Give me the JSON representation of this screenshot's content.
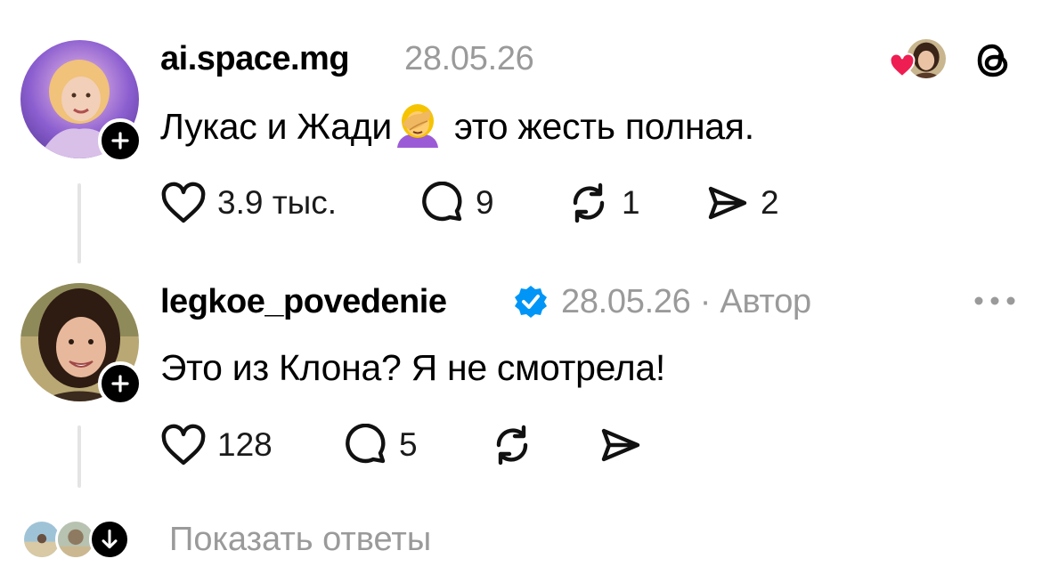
{
  "comments": [
    {
      "username": "ai.space.mg",
      "date": "28.05.26",
      "text_before_emoji": "Лукас и Жади",
      "emoji": "face-palm-emoji",
      "text_after_emoji": "это жесть полная.",
      "likes": "3.9 тыс.",
      "replies": "9",
      "reposts": "1",
      "shares": "2"
    },
    {
      "username": "legkoe_povedenie",
      "verified": true,
      "date": "28.05.26",
      "separator": "·",
      "author_label": "Автор",
      "text": "Это из Клона? Я не смотрела!",
      "likes": "128",
      "replies": "5"
    }
  ],
  "show_replies_label": "Показать ответы",
  "colors": {
    "heart": "#ee1d52",
    "verified": "#0095f6",
    "muted": "#9a9a9a",
    "thread_line": "#e4e4e4"
  }
}
